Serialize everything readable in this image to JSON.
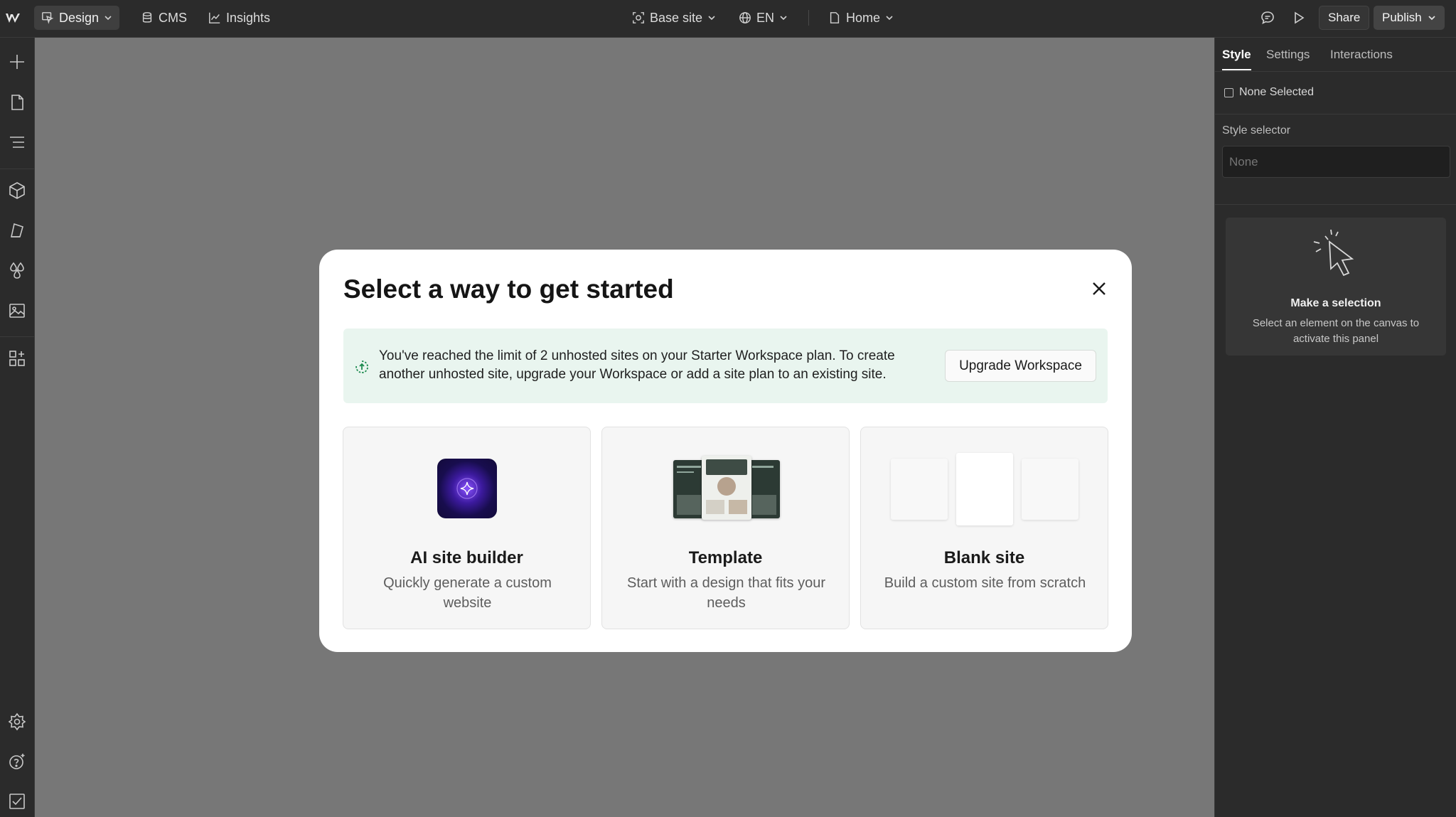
{
  "topbar": {
    "logo_icon": "webflow-logo",
    "design_label": "Design",
    "cms_label": "CMS",
    "insights_label": "Insights",
    "site_label": "Base site",
    "locale_label": "EN",
    "page_label": "Home",
    "share_label": "Share",
    "publish_label": "Publish"
  },
  "leftbar": {
    "icons": [
      "add-icon",
      "pages-icon",
      "navigator-icon",
      "components-icon",
      "style-manager-icon",
      "variables-icon",
      "assets-icon",
      "apps-icon",
      "settings-icon",
      "help-icon",
      "checklist-icon"
    ]
  },
  "rightpanel": {
    "tabs": [
      "Style",
      "Settings",
      "Interactions"
    ],
    "active_tab": "Style",
    "none_selected": "None Selected",
    "style_selector_label": "Style selector",
    "style_selector_placeholder": "None",
    "empty_title": "Make a selection",
    "empty_desc": "Select an element on the canvas to activate this panel"
  },
  "modal": {
    "title": "Select a way to get started",
    "notice_text": "You've reached the limit of 2 unhosted sites on your Starter Workspace plan. To create another unhosted site, upgrade your Workspace or add a site plan to an existing site.",
    "upgrade_label": "Upgrade Workspace",
    "options": [
      {
        "title": "AI site builder",
        "desc": "Quickly generate a custom website"
      },
      {
        "title": "Template",
        "desc": "Start with a design that fits your needs"
      },
      {
        "title": "Blank site",
        "desc": "Build a custom site from scratch"
      }
    ]
  },
  "colors": {
    "canvas": "#777777",
    "panel": "#2b2b2b",
    "notice_bg": "#e9f5ef",
    "ai_accent": "#8a52ff"
  }
}
